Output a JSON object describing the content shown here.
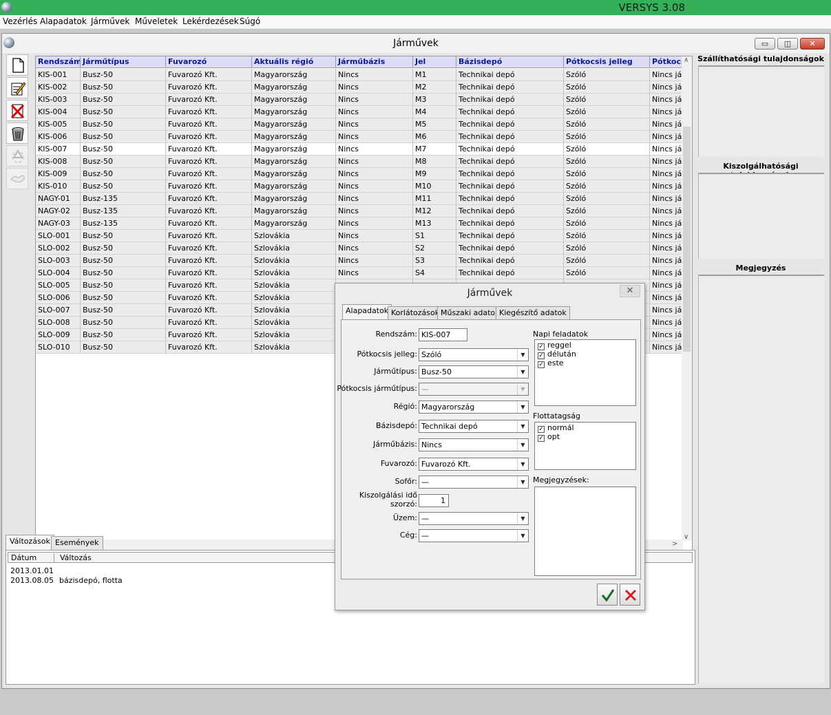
{
  "app": {
    "title": "VERSYS 3.08"
  },
  "menu": [
    "Vezérlés",
    "Alapadatok",
    "Járművek",
    "Műveletek",
    "Lekérdezések",
    "Súgó"
  ],
  "window": {
    "title": "Járművek"
  },
  "window_buttons": {
    "minimize": "▭",
    "restore": "◫",
    "close": "✕"
  },
  "toolbar": [
    "new-icon",
    "edit-icon",
    "delete-icon",
    "trash-icon",
    "recycle-icon",
    "handshake-icon"
  ],
  "grid": {
    "columns": [
      "Rendszám",
      "Járműtípus",
      "Fuvarozó",
      "Aktuális régió",
      "Járműbázis",
      "Jel",
      "Bázisdepó",
      "Pótkocsis jelleg",
      "Pótkocsi"
    ],
    "rows": [
      [
        "KIS-001",
        "Busz-50",
        "Fuvarozó Kft.",
        "Magyarország",
        "Nincs",
        "M1",
        "Technikai depó",
        "Szóló",
        "Nincs jár"
      ],
      [
        "KIS-002",
        "Busz-50",
        "Fuvarozó Kft.",
        "Magyarország",
        "Nincs",
        "M2",
        "Technikai depó",
        "Szóló",
        "Nincs jár"
      ],
      [
        "KIS-003",
        "Busz-50",
        "Fuvarozó Kft.",
        "Magyarország",
        "Nincs",
        "M3",
        "Technikai depó",
        "Szóló",
        "Nincs jár"
      ],
      [
        "KIS-004",
        "Busz-50",
        "Fuvarozó Kft.",
        "Magyarország",
        "Nincs",
        "M4",
        "Technikai depó",
        "Szóló",
        "Nincs jár"
      ],
      [
        "KIS-005",
        "Busz-50",
        "Fuvarozó Kft.",
        "Magyarország",
        "Nincs",
        "M5",
        "Technikai depó",
        "Szóló",
        "Nincs jár"
      ],
      [
        "KIS-006",
        "Busz-50",
        "Fuvarozó Kft.",
        "Magyarország",
        "Nincs",
        "M6",
        "Technikai depó",
        "Szóló",
        "Nincs jár"
      ],
      [
        "KIS-007",
        "Busz-50",
        "Fuvarozó Kft.",
        "Magyarország",
        "Nincs",
        "M7",
        "Technikai depó",
        "Szóló",
        "Nincs jár"
      ],
      [
        "KIS-008",
        "Busz-50",
        "Fuvarozó Kft.",
        "Magyarország",
        "Nincs",
        "M8",
        "Technikai depó",
        "Szóló",
        "Nincs jár"
      ],
      [
        "KIS-009",
        "Busz-50",
        "Fuvarozó Kft.",
        "Magyarország",
        "Nincs",
        "M9",
        "Technikai depó",
        "Szóló",
        "Nincs jár"
      ],
      [
        "KIS-010",
        "Busz-50",
        "Fuvarozó Kft.",
        "Magyarország",
        "Nincs",
        "M10",
        "Technikai depó",
        "Szóló",
        "Nincs jár"
      ],
      [
        "NAGY-01",
        "Busz-135",
        "Fuvarozó Kft.",
        "Magyarország",
        "Nincs",
        "M11",
        "Technikai depó",
        "Szóló",
        "Nincs jár"
      ],
      [
        "NAGY-02",
        "Busz-135",
        "Fuvarozó Kft.",
        "Magyarország",
        "Nincs",
        "M12",
        "Technikai depó",
        "Szóló",
        "Nincs jár"
      ],
      [
        "NAGY-03",
        "Busz-135",
        "Fuvarozó Kft.",
        "Magyarország",
        "Nincs",
        "M13",
        "Technikai depó",
        "Szóló",
        "Nincs jár"
      ],
      [
        "SLO-001",
        "Busz-50",
        "Fuvarozó Kft.",
        "Szlovákia",
        "Nincs",
        "S1",
        "Technikai depó",
        "Szóló",
        "Nincs jár"
      ],
      [
        "SLO-002",
        "Busz-50",
        "Fuvarozó Kft.",
        "Szlovákia",
        "Nincs",
        "S2",
        "Technikai depó",
        "Szóló",
        "Nincs jár"
      ],
      [
        "SLO-003",
        "Busz-50",
        "Fuvarozó Kft.",
        "Szlovákia",
        "Nincs",
        "S3",
        "Technikai depó",
        "Szóló",
        "Nincs jár"
      ],
      [
        "SLO-004",
        "Busz-50",
        "Fuvarozó Kft.",
        "Szlovákia",
        "Nincs",
        "S4",
        "Technikai depó",
        "Szóló",
        "Nincs jár"
      ],
      [
        "SLO-005",
        "Busz-50",
        "Fuvarozó Kft.",
        "Szlovákia",
        "",
        "",
        "",
        "",
        "Nincs jár"
      ],
      [
        "SLO-006",
        "Busz-50",
        "Fuvarozó Kft.",
        "Szlovákia",
        "",
        "",
        "",
        "",
        "Nincs jár"
      ],
      [
        "SLO-007",
        "Busz-50",
        "Fuvarozó Kft.",
        "Szlovákia",
        "",
        "",
        "",
        "",
        "Nincs jár"
      ],
      [
        "SLO-008",
        "Busz-50",
        "Fuvarozó Kft.",
        "Szlovákia",
        "",
        "",
        "",
        "",
        "Nincs jár"
      ],
      [
        "SLO-009",
        "Busz-50",
        "Fuvarozó Kft.",
        "Szlovákia",
        "",
        "",
        "",
        "",
        "Nincs jár"
      ],
      [
        "SLO-010",
        "Busz-50",
        "Fuvarozó Kft.",
        "Szlovákia",
        "",
        "",
        "",
        "",
        "Nincs jár"
      ]
    ],
    "selected_row": 6,
    "scroll_up": "∧",
    "scroll_down": "∨",
    "scroll_left": "<",
    "scroll_right": ">"
  },
  "props": {
    "transport": "Szállíthatósági tulajdonságok",
    "service": "Kiszolgálhatósági tulajdonságok",
    "note": "Megjegyzés"
  },
  "bottom": {
    "tabs": [
      "Változások",
      "Események"
    ],
    "active_tab": 0,
    "headers": [
      "Dátum",
      "Változás"
    ],
    "rows": [
      [
        "2013.01.01",
        ""
      ],
      [
        "2013.08.05",
        "bázisdepó, flotta"
      ]
    ]
  },
  "dialog": {
    "title": "Járművek",
    "close": "✕",
    "tabs": [
      "Alapadatok",
      "Korlátozások",
      "Műszaki adatok",
      "Kiegészítő adatok"
    ],
    "active_tab": 0,
    "fields": {
      "rendszam": {
        "label": "Rendszám:",
        "value": "KIS-007"
      },
      "potkocsis": {
        "label": "Pótkocsis jelleg:",
        "value": "Szóló"
      },
      "jarmutipus": {
        "label": "Járműtípus:",
        "value": "Busz-50"
      },
      "potkocsis_tipus": {
        "label": "Pótkocsis járműtípus:",
        "value": "—"
      },
      "regio": {
        "label": "Régió:",
        "value": "Magyarország"
      },
      "bazisdepo": {
        "label": "Bázisdepó:",
        "value": "Technikai depó"
      },
      "jarmubazis": {
        "label": "Járműbázis:",
        "value": "Nincs"
      },
      "fuvarozo": {
        "label": "Fuvarozó:",
        "value": "Fuvarozó Kft."
      },
      "sofor": {
        "label": "Sofőr:",
        "value": "—"
      },
      "szorzo": {
        "label_line1": "Kiszolgálási idő",
        "label_line2": "szorzó:",
        "value": "1"
      },
      "uzem": {
        "label": "Üzem:",
        "value": "—"
      },
      "ceg": {
        "label": "Cég:",
        "value": "—"
      }
    },
    "napi": {
      "title": "Napi feladatok",
      "items": [
        "reggel",
        "délután",
        "este"
      ]
    },
    "flotta": {
      "title": "Flottatagság",
      "items": [
        "normál",
        "opt"
      ]
    },
    "megjegyzesek": {
      "title": "Megjegyzések:",
      "value": ""
    },
    "check_mark": "✓"
  }
}
